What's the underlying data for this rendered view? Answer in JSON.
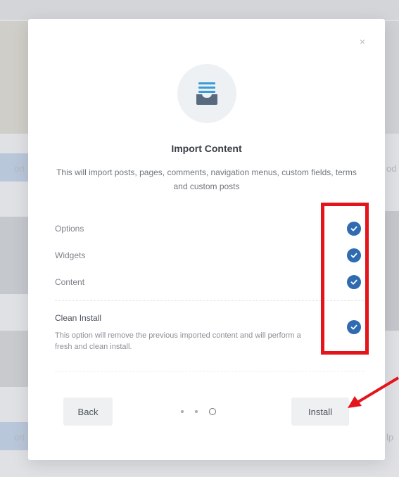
{
  "background": {
    "side_texts": [
      "ort",
      "od",
      "ort",
      "lp"
    ]
  },
  "modal": {
    "close_glyph": "×",
    "hero_icon": "inbox-stack-icon",
    "title": "Import Content",
    "subtitle": "This will import posts, pages, comments, navigation menus, custom fields, terms and custom posts",
    "options": [
      {
        "label": "Options",
        "checked": true
      },
      {
        "label": "Widgets",
        "checked": true
      },
      {
        "label": "Content",
        "checked": true
      }
    ],
    "clean_install": {
      "title": "Clean Install",
      "description": "This option will remove the previous imported content and will perform a fresh and clean install.",
      "checked": true
    },
    "back_label": "Back",
    "install_label": "Install",
    "steps": {
      "count": 3,
      "current": 3
    }
  },
  "colors": {
    "accent": "#2f6bb0",
    "annotation": "#e4141b"
  }
}
